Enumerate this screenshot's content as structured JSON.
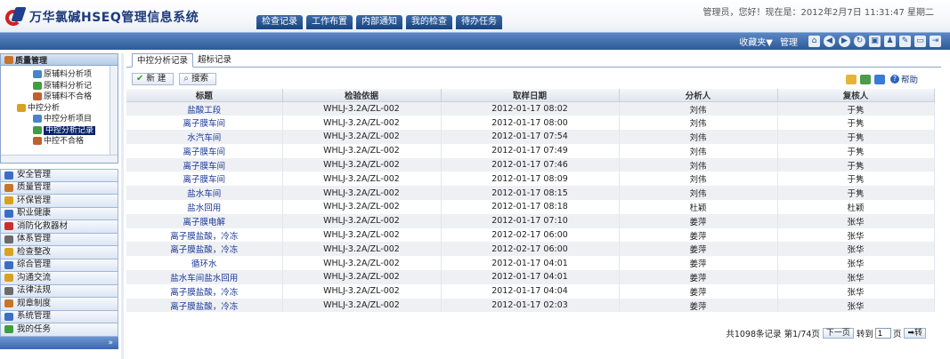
{
  "app": {
    "title": "万华氯碱HSEQ管理信息系统",
    "user_info": "管理员，您好！现在是：2012年2月7日  11:31:47 星期二"
  },
  "top_tabs": [
    "检查记录",
    "工作布置",
    "内部通知",
    "我的检查",
    "待办任务"
  ],
  "strip": {
    "favorites": "收藏夹▼",
    "manage": "管理"
  },
  "tree": {
    "header": "质量管理",
    "nodes": [
      {
        "label": "原辅料分析项",
        "indent": 3,
        "icon_color": "#4a83c7"
      },
      {
        "label": "原辅料分析记",
        "indent": 3,
        "icon_color": "#3f9e3f"
      },
      {
        "label": "原辅料不合格",
        "indent": 3,
        "icon_color": "#c06030"
      },
      {
        "label": "中控分析",
        "indent": 1,
        "icon_color": "#d9a21e"
      },
      {
        "label": "中控分析项目",
        "indent": 3,
        "icon_color": "#4a83c7"
      },
      {
        "label": "中控分析记录",
        "indent": 3,
        "icon_color": "#3f9e3f",
        "selected": true
      },
      {
        "label": "中控不合格",
        "indent": 3,
        "icon_color": "#c06030"
      }
    ]
  },
  "nav": [
    {
      "label": "安全管理",
      "icon_color": "#3b6fc4"
    },
    {
      "label": "质量管理",
      "icon_color": "#c8742b"
    },
    {
      "label": "环保管理",
      "icon_color": "#d9a21e"
    },
    {
      "label": "职业健康",
      "icon_color": "#3b6fc4"
    },
    {
      "label": "消防化救器材",
      "icon_color": "#c83030"
    },
    {
      "label": "体系管理",
      "icon_color": "#6b6b6b"
    },
    {
      "label": "检查整改",
      "icon_color": "#d9a21e"
    },
    {
      "label": "综合管理",
      "icon_color": "#3b6fc4"
    },
    {
      "label": "沟通交流",
      "icon_color": "#d9a21e"
    },
    {
      "label": "法律法规",
      "icon_color": "#6b6b6b"
    },
    {
      "label": "规章制度",
      "icon_color": "#c8742b"
    },
    {
      "label": "系统管理",
      "icon_color": "#3b6fc4"
    },
    {
      "label": "我的任务",
      "icon_color": "#3f9e3f"
    }
  ],
  "left_footer": "»",
  "subtabs": [
    "中控分析记录",
    "超标记录"
  ],
  "actions": {
    "new": "新 建",
    "search": "搜索",
    "help": "帮助"
  },
  "columns": [
    "标题",
    "检验依据",
    "取样日期",
    "分析人",
    "复核人"
  ],
  "rows": [
    [
      "盐酸工段",
      "WHLJ-3.2A/ZL-002",
      "2012-01-17 08:02",
      "刘伟",
      "于隽"
    ],
    [
      "离子膜车间",
      "WHLJ-3.2A/ZL-002",
      "2012-01-17 08:00",
      "刘伟",
      "于隽"
    ],
    [
      "水汽车间",
      "WHLJ-3.2A/ZL-002",
      "2012-01-17 07:54",
      "刘伟",
      "于隽"
    ],
    [
      "离子膜车间",
      "WHLJ-3.2A/ZL-002",
      "2012-01-17 07:49",
      "刘伟",
      "于隽"
    ],
    [
      "离子膜车间",
      "WHLJ-3.2A/ZL-002",
      "2012-01-17 07:46",
      "刘伟",
      "于隽"
    ],
    [
      "离子膜车间",
      "WHLJ-3.2A/ZL-002",
      "2012-01-17 08:09",
      "刘伟",
      "于隽"
    ],
    [
      "盐水车间",
      "WHLJ-3.2A/ZL-002",
      "2012-01-17 08:15",
      "刘伟",
      "于隽"
    ],
    [
      "盐水回用",
      "WHLJ-3.2A/ZL-002",
      "2012-01-17 08:18",
      "杜颖",
      "杜颖"
    ],
    [
      "离子膜电解",
      "WHLJ-3.2A/ZL-002",
      "2012-01-17 07:10",
      "姜萍",
      "张华"
    ],
    [
      "离子膜盐酸，冷冻",
      "WHLJ-3.2A/ZL-002",
      "2012-02-17 06:00",
      "姜萍",
      "张华"
    ],
    [
      "离子膜盐酸，冷冻",
      "WHLJ-3.2A/ZL-002",
      "2012-02-17 06:00",
      "姜萍",
      "张华"
    ],
    [
      "循环水",
      "WHLJ-3.2A/ZL-002",
      "2012-01-17 04:01",
      "姜萍",
      "张华"
    ],
    [
      "盐水车间盐水回用",
      "WHLJ-3.2A/ZL-002",
      "2012-01-17 04:01",
      "姜萍",
      "张华"
    ],
    [
      "离子膜盐酸，冷冻",
      "WHLJ-3.2A/ZL-002",
      "2012-01-17 04:04",
      "姜萍",
      "张华"
    ],
    [
      "离子膜盐酸，冷冻",
      "WHLJ-3.2A/ZL-002",
      "2012-01-17 02:03",
      "姜萍",
      "张华"
    ]
  ],
  "pager": {
    "summary": "共1098条记录 第1/74页",
    "next": "下一页",
    "goto": "转到",
    "page_value": "1",
    "page_unit": "页",
    "go": "➡转"
  }
}
